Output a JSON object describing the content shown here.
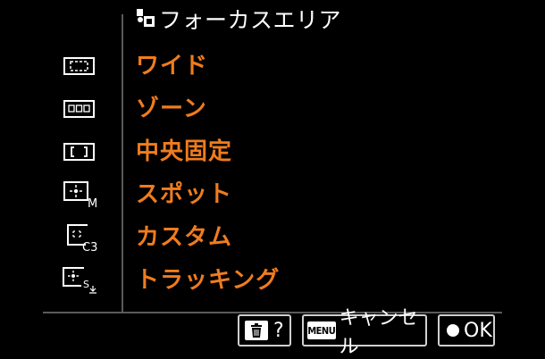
{
  "header": {
    "title": "フォーカスエリア",
    "title_icon": "camera-af-icon"
  },
  "menu": {
    "items": [
      {
        "label": "ワイド",
        "icon": "af-wide-icon"
      },
      {
        "label": "ゾーン",
        "icon": "af-zone-icon"
      },
      {
        "label": "中央固定",
        "icon": "af-center-icon"
      },
      {
        "label": "スポット",
        "icon": "af-spot-icon",
        "icon_sub": "M"
      },
      {
        "label": "カスタム",
        "icon": "af-custom-icon",
        "icon_sub": "C3"
      },
      {
        "label": "トラッキング",
        "icon": "af-tracking-icon",
        "icon_sub": "S"
      }
    ],
    "label_color": "#f07c1d"
  },
  "footer": {
    "delete_label": "?",
    "delete_icon": "trash-icon",
    "menu_badge": "MENU",
    "cancel_label": "キャンセル",
    "ok_label": "OK",
    "ok_icon": "center-button-dot-icon"
  }
}
